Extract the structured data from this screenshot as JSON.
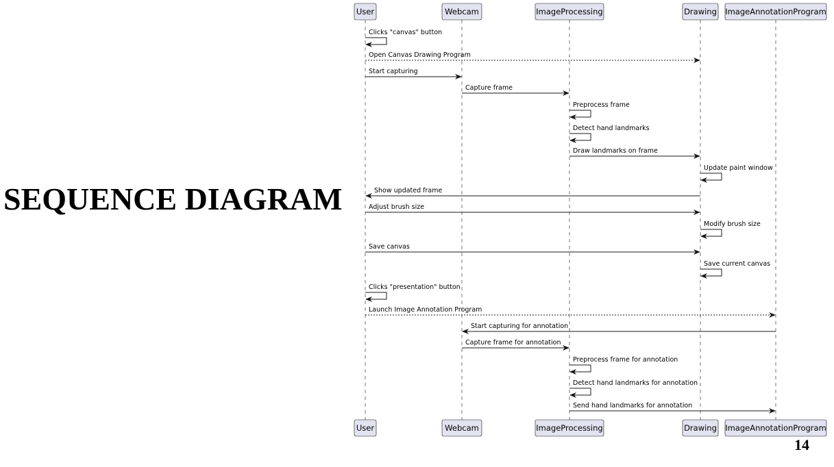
{
  "slide": {
    "title": "SEQUENCE DIAGRAM",
    "page_number": "14"
  },
  "diagram": {
    "colors": {
      "participant_fill": "#e2e2f0",
      "participant_border": "#181818",
      "lifeline": "#181818",
      "arrow": "#181818",
      "text": "#000000"
    },
    "participants": [
      {
        "id": "user",
        "label": "User"
      },
      {
        "id": "webcam",
        "label": "Webcam"
      },
      {
        "id": "imageprocessing",
        "label": "ImageProcessing"
      },
      {
        "id": "drawing",
        "label": "Drawing"
      },
      {
        "id": "annotation",
        "label": "ImageAnnotationProgram"
      }
    ],
    "messages": [
      {
        "from": "user",
        "to": "user",
        "label": "Clicks \"canvas\" button",
        "style": "solid"
      },
      {
        "from": "user",
        "to": "drawing",
        "label": "Open Canvas Drawing Program",
        "style": "dotted"
      },
      {
        "from": "user",
        "to": "webcam",
        "label": "Start capturing",
        "style": "solid"
      },
      {
        "from": "webcam",
        "to": "imageprocessing",
        "label": "Capture frame",
        "style": "solid"
      },
      {
        "from": "imageprocessing",
        "to": "imageprocessing",
        "label": "Preprocess frame",
        "style": "solid"
      },
      {
        "from": "imageprocessing",
        "to": "imageprocessing",
        "label": "Detect hand landmarks",
        "style": "solid"
      },
      {
        "from": "imageprocessing",
        "to": "drawing",
        "label": "Draw landmarks on frame",
        "style": "solid"
      },
      {
        "from": "drawing",
        "to": "drawing",
        "label": "Update paint window",
        "style": "solid"
      },
      {
        "from": "drawing",
        "to": "user",
        "label": "Show updated frame",
        "style": "solid"
      },
      {
        "from": "user",
        "to": "drawing",
        "label": "Adjust brush size",
        "style": "solid"
      },
      {
        "from": "drawing",
        "to": "drawing",
        "label": "Modify brush size",
        "style": "solid"
      },
      {
        "from": "user",
        "to": "drawing",
        "label": "Save canvas",
        "style": "solid"
      },
      {
        "from": "drawing",
        "to": "drawing",
        "label": "Save current canvas",
        "style": "solid"
      },
      {
        "from": "user",
        "to": "user",
        "label": "Clicks \"presentation\" button",
        "style": "solid"
      },
      {
        "from": "user",
        "to": "annotation",
        "label": "Launch Image Annotation Program",
        "style": "dotted"
      },
      {
        "from": "annotation",
        "to": "webcam",
        "label": "Start capturing for annotation",
        "style": "solid"
      },
      {
        "from": "webcam",
        "to": "imageprocessing",
        "label": "Capture frame for annotation",
        "style": "solid"
      },
      {
        "from": "imageprocessing",
        "to": "imageprocessing",
        "label": "Preprocess frame for annotation",
        "style": "solid"
      },
      {
        "from": "imageprocessing",
        "to": "imageprocessing",
        "label": "Detect hand landmarks for annotation",
        "style": "solid"
      },
      {
        "from": "imageprocessing",
        "to": "annotation",
        "label": "Send hand landmarks for annotation",
        "style": "solid"
      }
    ]
  }
}
